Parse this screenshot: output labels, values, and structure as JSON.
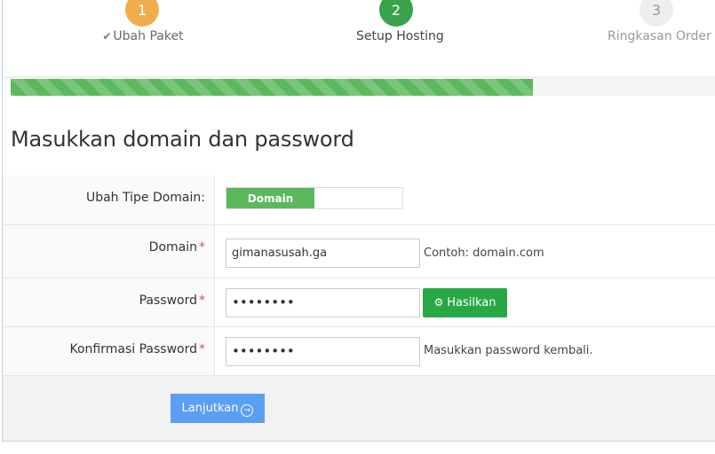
{
  "steps": [
    {
      "number": "1",
      "label": "Ubah Paket",
      "state": "completed",
      "color": "#f0ad4e"
    },
    {
      "number": "2",
      "label": "Setup Hosting",
      "state": "active",
      "color": "#39a24a"
    },
    {
      "number": "3",
      "label": "Ringkasan Order",
      "state": "pending",
      "color": "#eeeeee"
    }
  ],
  "progress": {
    "percent": 73.5,
    "color": "#5cb85c"
  },
  "form": {
    "title": "Masukkan domain dan password",
    "domain_type": {
      "label": "Ubah Tipe Domain:",
      "selected": "Domain"
    },
    "domain": {
      "label": "Domain",
      "required": "*",
      "value": "gimanasusah.ga",
      "hint": "Contoh: domain.com"
    },
    "password": {
      "label": "Password",
      "required": "*",
      "value": "••••••••",
      "button": "Hasilkan"
    },
    "confirm": {
      "label": "Konfirmasi Password",
      "required": "*",
      "value": "••••••••",
      "hint": "Masukkan password kembali."
    }
  },
  "actions": {
    "next_label": "Lanjutkan",
    "next_color": "#5b9ef4"
  },
  "icons": {
    "step1": "check-icon",
    "generate": "gear-icon",
    "next": "arrow-circle-right-icon"
  }
}
